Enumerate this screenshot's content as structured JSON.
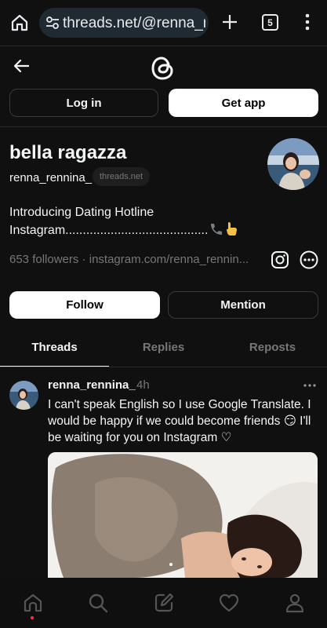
{
  "browser": {
    "url": "threads.net/@renna_re",
    "tab_count": "5"
  },
  "auth": {
    "login_label": "Log in",
    "getapp_label": "Get app"
  },
  "profile": {
    "name": "bella ragazza",
    "handle": "renna_rennina_",
    "domain_badge": "threads.net",
    "bio_line1": "Introducing Dating Hotline",
    "bio_line2": "Instagram.........................................",
    "followers": "653 followers",
    "separator": "·",
    "link": "instagram.com/renna_rennin..."
  },
  "actions": {
    "follow_label": "Follow",
    "mention_label": "Mention"
  },
  "tabs": [
    {
      "label": "Threads",
      "active": true
    },
    {
      "label": "Replies",
      "active": false
    },
    {
      "label": "Reposts",
      "active": false
    }
  ],
  "post": {
    "username": "renna_rennina_",
    "time": "4h",
    "line1": "I can't speak English so I use Google Translate. I",
    "line2": "would be happy if we could become friends 😏 I'll",
    "line3": "be waiting for you on Instagram ♡"
  },
  "nav": {
    "icons": [
      "home-icon",
      "search-icon",
      "compose-icon",
      "heart-icon",
      "profile-icon"
    ]
  },
  "colors": {
    "background": "#101010",
    "text": "#f3f5f7",
    "secondary_text": "#777777",
    "url_bar": "#1f2a33",
    "notification_dot": "#ff3040"
  }
}
